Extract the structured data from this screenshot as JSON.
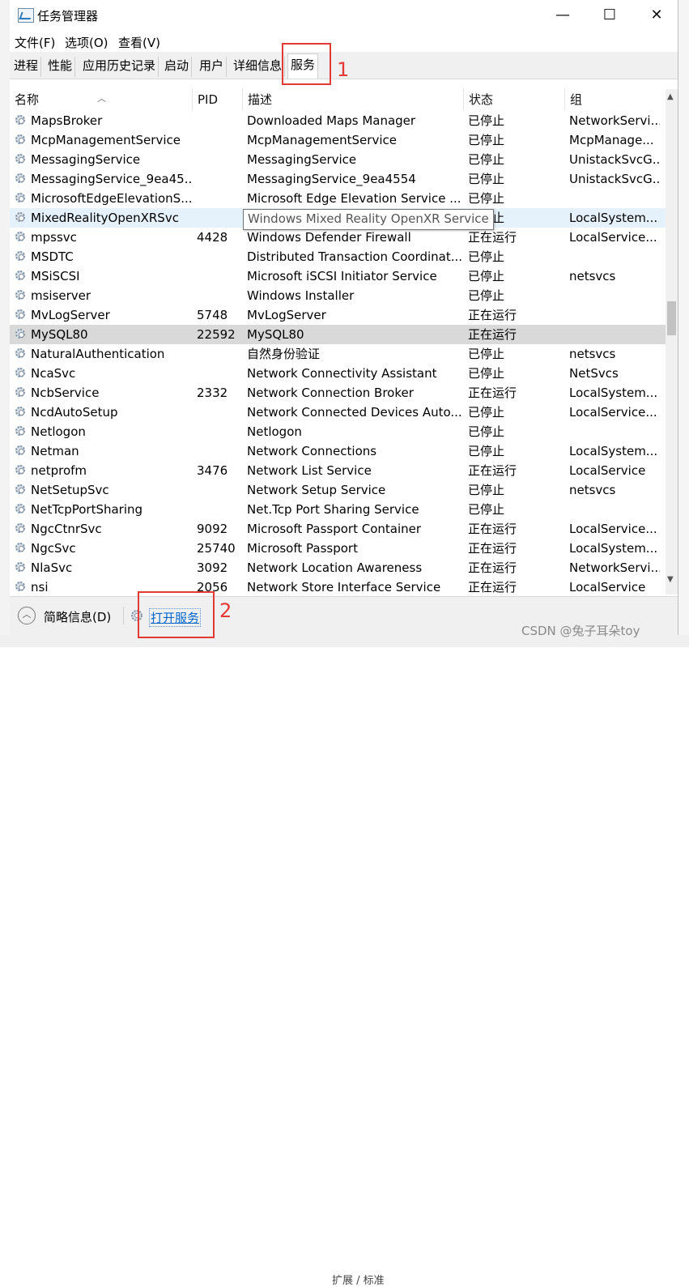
{
  "window": {
    "title": "任务管理器",
    "controls": {
      "minimize": "—",
      "maximize": "☐",
      "close": "✕"
    }
  },
  "menu": [
    "文件(F)",
    "选项(O)",
    "查看(V)"
  ],
  "tabs": [
    "进程",
    "性能",
    "应用历史记录",
    "启动",
    "用户",
    "详细信息",
    "服务"
  ],
  "active_tab": "服务",
  "annotations": {
    "tab_number": "1",
    "button_number": "2"
  },
  "columns": {
    "name": "名称",
    "pid": "PID",
    "desc": "描述",
    "status": "状态",
    "group": "组"
  },
  "tooltip": "Windows Mixed Reality OpenXR Service",
  "rows": [
    {
      "name": "MapsBroker",
      "pid": "",
      "desc": "Downloaded Maps Manager",
      "status": "已停止",
      "group": "NetworkServi..."
    },
    {
      "name": "McpManagementService",
      "pid": "",
      "desc": "McpManagementService",
      "status": "已停止",
      "group": "McpManage..."
    },
    {
      "name": "MessagingService",
      "pid": "",
      "desc": "MessagingService",
      "status": "已停止",
      "group": "UnistackSvcG..."
    },
    {
      "name": "MessagingService_9ea45...",
      "pid": "",
      "desc": "MessagingService_9ea4554",
      "status": "已停止",
      "group": "UnistackSvcG..."
    },
    {
      "name": "MicrosoftEdgeElevationS...",
      "pid": "",
      "desc": "Microsoft Edge Elevation Service ...",
      "status": "已停止",
      "group": ""
    },
    {
      "name": "MixedRealityOpenXRSvc",
      "pid": "",
      "desc": "",
      "status": "已停止",
      "group": "LocalSystem..."
    },
    {
      "name": "mpssvc",
      "pid": "4428",
      "desc": "Windows Defender Firewall",
      "status": "正在运行",
      "group": "LocalService..."
    },
    {
      "name": "MSDTC",
      "pid": "",
      "desc": "Distributed Transaction Coordinat...",
      "status": "已停止",
      "group": ""
    },
    {
      "name": "MSiSCSI",
      "pid": "",
      "desc": "Microsoft iSCSI Initiator Service",
      "status": "已停止",
      "group": "netsvcs"
    },
    {
      "name": "msiserver",
      "pid": "",
      "desc": "Windows Installer",
      "status": "已停止",
      "group": ""
    },
    {
      "name": "MvLogServer",
      "pid": "5748",
      "desc": "MvLogServer",
      "status": "正在运行",
      "group": ""
    },
    {
      "name": "MySQL80",
      "pid": "22592",
      "desc": "MySQL80",
      "status": "正在运行",
      "group": ""
    },
    {
      "name": "NaturalAuthentication",
      "pid": "",
      "desc": "自然身份验证",
      "status": "已停止",
      "group": "netsvcs"
    },
    {
      "name": "NcaSvc",
      "pid": "",
      "desc": "Network Connectivity Assistant",
      "status": "已停止",
      "group": "NetSvcs"
    },
    {
      "name": "NcbService",
      "pid": "2332",
      "desc": "Network Connection Broker",
      "status": "正在运行",
      "group": "LocalSystem..."
    },
    {
      "name": "NcdAutoSetup",
      "pid": "",
      "desc": "Network Connected Devices Auto...",
      "status": "已停止",
      "group": "LocalService..."
    },
    {
      "name": "Netlogon",
      "pid": "",
      "desc": "Netlogon",
      "status": "已停止",
      "group": ""
    },
    {
      "name": "Netman",
      "pid": "",
      "desc": "Network Connections",
      "status": "已停止",
      "group": "LocalSystem..."
    },
    {
      "name": "netprofm",
      "pid": "3476",
      "desc": "Network List Service",
      "status": "正在运行",
      "group": "LocalService"
    },
    {
      "name": "NetSetupSvc",
      "pid": "",
      "desc": "Network Setup Service",
      "status": "已停止",
      "group": "netsvcs"
    },
    {
      "name": "NetTcpPortSharing",
      "pid": "",
      "desc": "Net.Tcp Port Sharing Service",
      "status": "已停止",
      "group": ""
    },
    {
      "name": "NgcCtnrSvc",
      "pid": "9092",
      "desc": "Microsoft Passport Container",
      "status": "正在运行",
      "group": "LocalService..."
    },
    {
      "name": "NgcSvc",
      "pid": "25740",
      "desc": "Microsoft Passport",
      "status": "正在运行",
      "group": "LocalSystem..."
    },
    {
      "name": "NlaSvc",
      "pid": "3092",
      "desc": "Network Location Awareness",
      "status": "正在运行",
      "group": "NetworkServi..."
    },
    {
      "name": "nsi",
      "pid": "2056",
      "desc": "Network Store Interface Service",
      "status": "正在运行",
      "group": "LocalService"
    }
  ],
  "footer": {
    "less_info": "简略信息(D)",
    "open_services": "打开服务"
  },
  "watermark": "CSDN @兔子耳朵toy",
  "background_text": "扩展 / 标准"
}
